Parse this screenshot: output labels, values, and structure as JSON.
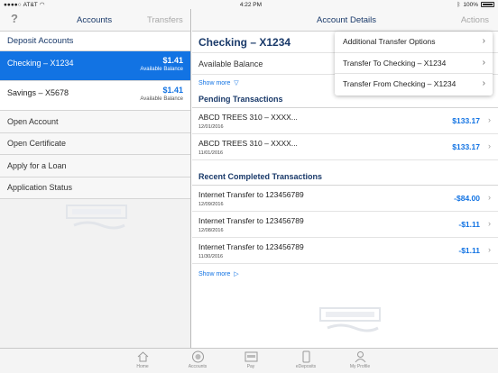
{
  "status_bar": {
    "carrier": "AT&T",
    "time": "4:22 PM",
    "battery": "100%"
  },
  "left_nav": {
    "help_icon": "?",
    "tab_accounts": "Accounts",
    "tab_transfers": "Transfers"
  },
  "deposit_section": {
    "title": "Deposit Accounts"
  },
  "accounts": [
    {
      "name": "Checking – X1234",
      "amount": "$1.41",
      "label": "Available Balance"
    },
    {
      "name": "Savings – X5678",
      "amount": "$1.41",
      "label": "Available Balance"
    }
  ],
  "menu": [
    "Open Account",
    "Open Certificate",
    "Apply for a Loan",
    "Application Status"
  ],
  "right_nav": {
    "title": "Account Details",
    "actions": "Actions"
  },
  "account_detail": {
    "title": "Checking – X1234",
    "available_label": "Available Balance",
    "show_more": "Show more"
  },
  "pending": {
    "title": "Pending Transactions",
    "items": [
      {
        "desc": "ABCD TREES 310 – XXXX...",
        "date": "12/01/2016",
        "amount": "$133.17"
      },
      {
        "desc": "ABCD TREES 310 – XXXX...",
        "date": "11/01/2016",
        "amount": "$133.17"
      }
    ]
  },
  "completed": {
    "title": "Recent Completed Transactions",
    "items": [
      {
        "desc": "Internet Transfer to 123456789",
        "date": "12/09/2016",
        "amount": "-$84.00"
      },
      {
        "desc": "Internet Transfer to 123456789",
        "date": "12/08/2016",
        "amount": "-$1.11"
      },
      {
        "desc": "Internet Transfer to 123456789",
        "date": "11/30/2016",
        "amount": "-$1.11"
      }
    ],
    "show_more": "Show more"
  },
  "actions_menu": [
    "Additional Transfer Options",
    "Transfer To Checking – X1234",
    "Transfer From Checking – X1234"
  ],
  "tabbar": [
    "Home",
    "Accounts",
    "Pay",
    "eDeposits",
    "My Profile"
  ],
  "colors": {
    "accent": "#1273e3",
    "navy": "#1a3a6a",
    "selected_row": "#1273e3"
  }
}
